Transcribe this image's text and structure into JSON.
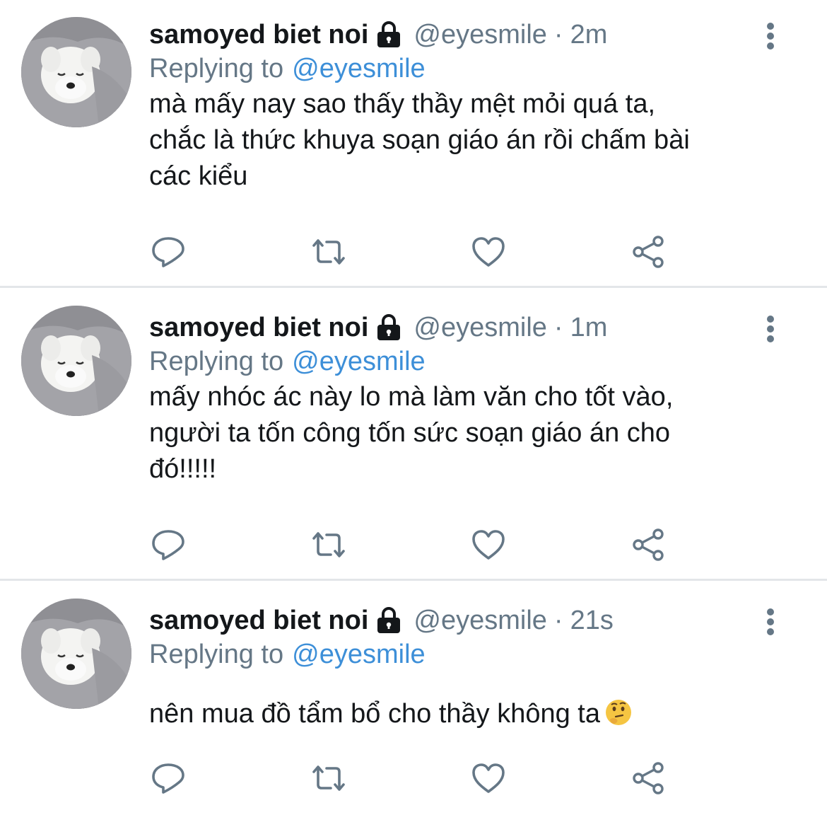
{
  "tweets": [
    {
      "author_name": "samoyed biet noi",
      "handle": "@eyesmile",
      "separator": "·",
      "time": "2m",
      "replying_label": "Replying to",
      "replying_to": "@eyesmile",
      "text_lines": [
        "mà mấy nay sao thấy thầy mệt mỏi quá ta,",
        "chắc là thức khuya soạn giáo án rồi chấm bài",
        "các kiểu"
      ]
    },
    {
      "author_name": "samoyed biet noi",
      "handle": "@eyesmile",
      "separator": "·",
      "time": "1m",
      "replying_label": "Replying to",
      "replying_to": "@eyesmile",
      "text_lines": [
        "mấy nhóc ác này lo mà làm văn cho tốt vào,",
        "người ta tốn công tốn sức soạn giáo án cho",
        "đó!!!!!"
      ]
    },
    {
      "author_name": "samoyed biet noi",
      "handle": "@eyesmile",
      "separator": "·",
      "time": "21s",
      "replying_label": "Replying to",
      "replying_to": "@eyesmile",
      "text_lines": [
        "nên mua đồ tẩm bổ cho thầy không ta"
      ],
      "emoji": "thinking-face"
    }
  ],
  "icons": {
    "lock": "lock-icon",
    "more": "more-vertical-icon",
    "reply": "reply-icon",
    "retweet": "retweet-icon",
    "like": "like-icon",
    "share": "share-icon"
  },
  "colors": {
    "text": "#14171a",
    "secondary": "#657786",
    "link": "#3d8fd8",
    "divider": "#e3e6e9"
  }
}
